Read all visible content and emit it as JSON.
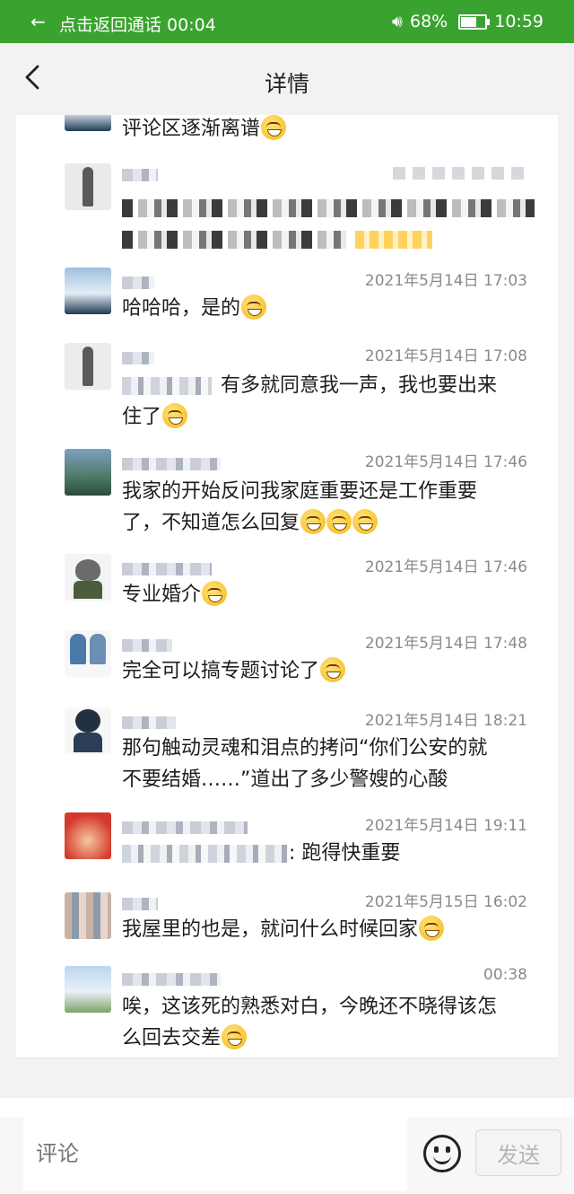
{
  "status_bar": {
    "call_text": "点击返回通话 00:04",
    "battery": "68%",
    "battery_level": 0.68,
    "time": "10:59"
  },
  "header": {
    "title": "详情"
  },
  "comments": [
    {
      "time": "",
      "text": "评论区逐渐离谱"
    },
    {
      "time": "",
      "text": ""
    },
    {
      "time": "2021年5月14日 17:03",
      "text": "哈哈哈，是的"
    },
    {
      "time": "2021年5月14日 17:08",
      "text_tail": "有多就同意我一声，我也要出来",
      "text2": "住了"
    },
    {
      "time": "2021年5月14日 17:46",
      "text": "我家的开始反问我家庭重要还是工作重要",
      "text2": "了，不知道怎么回复"
    },
    {
      "time": "2021年5月14日 17:46",
      "text": "专业婚介"
    },
    {
      "time": "2021年5月14日 17:48",
      "text": "完全可以搞专题讨论了"
    },
    {
      "time": "2021年5月14日 18:21",
      "text": "那句触动灵魂和泪点的拷问“你们公安的就",
      "text2": "不要结婚……”道出了多少警嫂的心酸"
    },
    {
      "time": "2021年5月14日 19:11",
      "text_tail": ": 跑得快重要"
    },
    {
      "time": "2021年5月15日 16:02",
      "text": "我屋里的也是，就问什么时候回家"
    },
    {
      "time": "00:38",
      "text": "唉，这该死的熟悉对白，今晚还不晓得该怎",
      "text2": "么回去交差"
    }
  ],
  "bottom_bar": {
    "placeholder": "评论",
    "send_label": "发送"
  }
}
